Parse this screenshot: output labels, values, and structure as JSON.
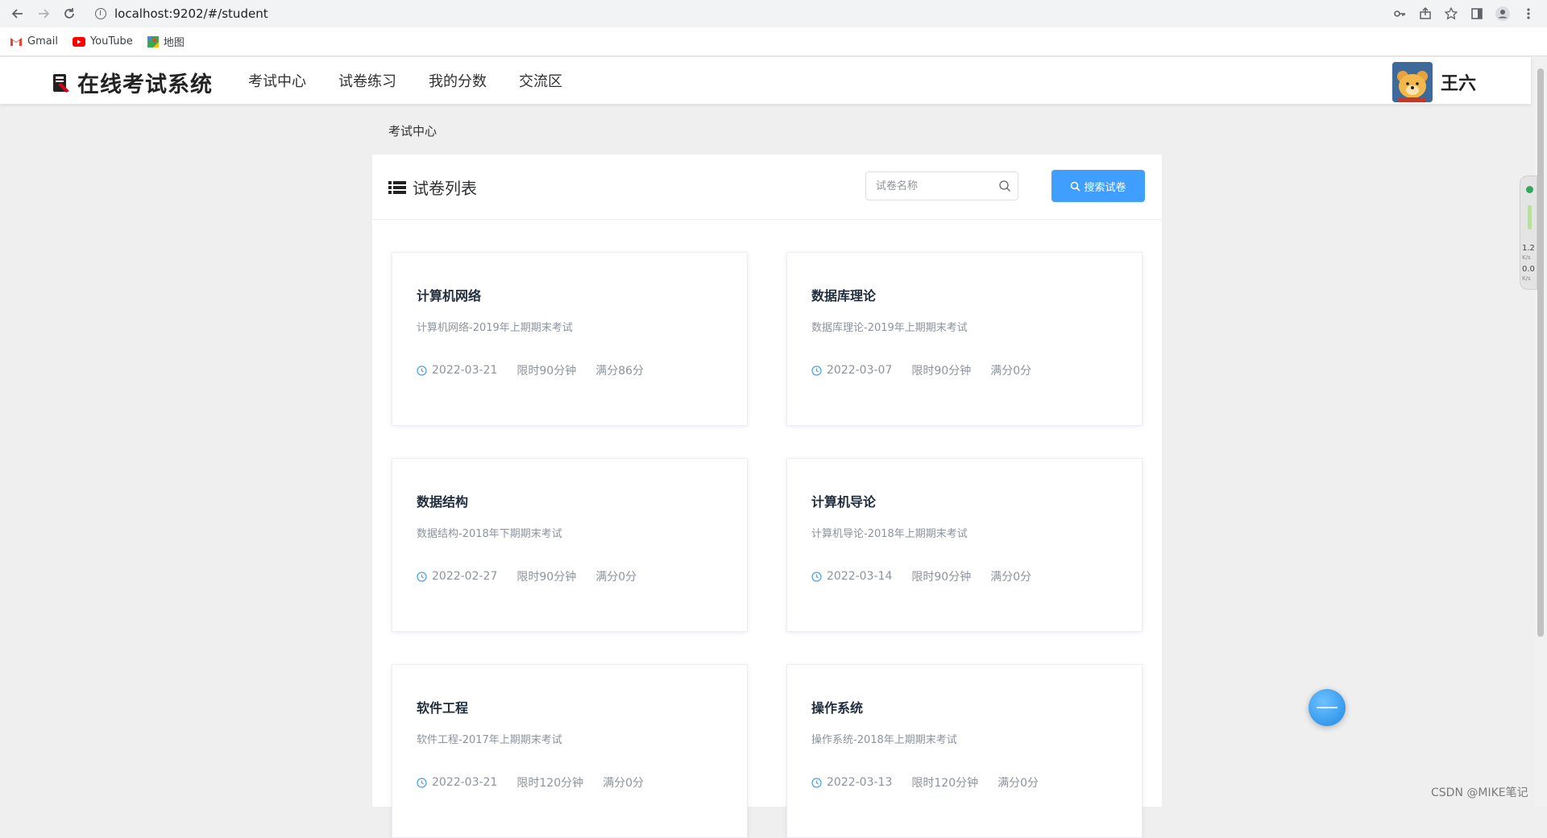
{
  "browser": {
    "url": "localhost:9202/#/student",
    "bookmarks": [
      {
        "label": "Gmail",
        "icon": "gmail-icon"
      },
      {
        "label": "YouTube",
        "icon": "youtube-icon"
      },
      {
        "label": "地图",
        "icon": "maps-icon"
      }
    ]
  },
  "header": {
    "logo_text": "在线考试系统",
    "nav": [
      "考试中心",
      "试卷练习",
      "我的分数",
      "交流区"
    ],
    "username": "王六"
  },
  "breadcrumb": "考试中心",
  "panel": {
    "title": "试卷列表",
    "search_placeholder": "试卷名称",
    "search_button": "搜索试卷"
  },
  "papers": [
    {
      "title": "计算机网络",
      "desc": "计算机网络-2019年上期期末考试",
      "date": "2022-03-21",
      "time_limit": "限时90分钟",
      "full_score": "满分86分"
    },
    {
      "title": "数据库理论",
      "desc": "数据库理论-2019年上期期末考试",
      "date": "2022-03-07",
      "time_limit": "限时90分钟",
      "full_score": "满分0分"
    },
    {
      "title": "数据结构",
      "desc": "数据结构-2018年下期期末考试",
      "date": "2022-02-27",
      "time_limit": "限时90分钟",
      "full_score": "满分0分"
    },
    {
      "title": "计算机导论",
      "desc": "计算机导论-2018年上期期末考试",
      "date": "2022-03-14",
      "time_limit": "限时90分钟",
      "full_score": "满分0分"
    },
    {
      "title": "软件工程",
      "desc": "软件工程-2017年上期期末考试",
      "date": "2022-03-21",
      "time_limit": "限时120分钟",
      "full_score": "满分0分"
    },
    {
      "title": "操作系统",
      "desc": "操作系统-2018年上期期末考试",
      "date": "2022-03-13",
      "time_limit": "限时120分钟",
      "full_score": "满分0分"
    }
  ],
  "net_widget": {
    "up": "1.2",
    "up_unit": "K/s",
    "down": "0.0",
    "down_unit": "K/s"
  },
  "watermark": "CSDN @MIKE笔记",
  "colors": {
    "primary": "#409eff",
    "meta_text": "#8c939d",
    "page_bg": "#efefef"
  }
}
